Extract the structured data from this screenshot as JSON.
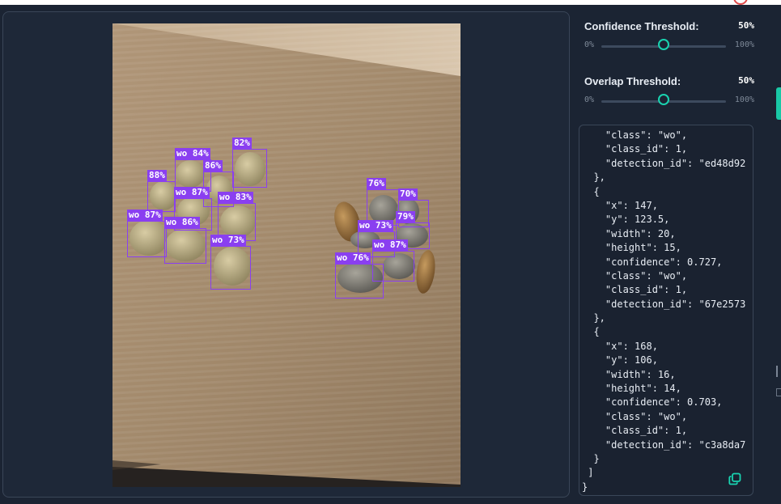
{
  "sliders": {
    "confidence": {
      "title": "Confidence Threshold:",
      "value_text": "50%",
      "min_label": "0%",
      "max_label": "100%",
      "value": 0.5
    },
    "overlap": {
      "title": "Overlap Threshold:",
      "value_text": "50%",
      "min_label": "0%",
      "max_label": "100%",
      "value": 0.5
    }
  },
  "detections": [
    {
      "label": "82%"
    },
    {
      "label": "wo 84%"
    },
    {
      "label": "86%"
    },
    {
      "label": "88%"
    },
    {
      "label": "wo 87%"
    },
    {
      "label": "wo 83%"
    },
    {
      "label": "wo 87%"
    },
    {
      "label": "wo 86%"
    },
    {
      "label": "wo 73%"
    },
    {
      "label": "76%"
    },
    {
      "label": "70%"
    },
    {
      "label": "79%"
    },
    {
      "label": "wo 73%"
    },
    {
      "label": "wo 87%"
    },
    {
      "label": "wo 76%"
    }
  ],
  "json_output": {
    "lines": [
      "    \"class\": \"wo\",",
      "    \"class_id\": 1,",
      "    \"detection_id\": \"ed48d92",
      "  },",
      "  {",
      "    \"x\": 147,",
      "    \"y\": 123.5,",
      "    \"width\": 20,",
      "    \"height\": 15,",
      "    \"confidence\": 0.727,",
      "    \"class\": \"wo\",",
      "    \"class_id\": 1,",
      "    \"detection_id\": \"67e2573",
      "  },",
      "  {",
      "    \"x\": 168,",
      "    \"y\": 106,",
      "    \"width\": 16,",
      "    \"height\": 14,",
      "    \"confidence\": 0.703,",
      "    \"class\": \"wo\",",
      "    \"class_id\": 1,",
      "    \"detection_id\": \"c3a8da7",
      "  }",
      " ]",
      "}"
    ]
  },
  "colors": {
    "accent": "#19d3b0",
    "detection_box": "#8a3ff0",
    "background": "#1b2433"
  },
  "icons": {
    "copy": "copy-icon"
  }
}
